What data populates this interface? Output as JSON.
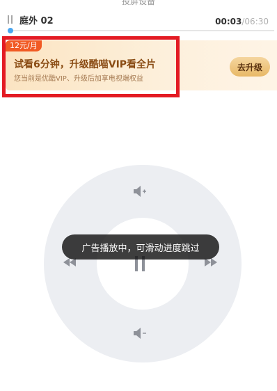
{
  "header": {
    "top_title_cut": "投屏设备"
  },
  "now_playing": {
    "title": "庭外 02",
    "current_time": "00:03",
    "separator_total": "/06:30",
    "progress_fraction": 0.008
  },
  "vip_banner": {
    "price_tag": "12元/月",
    "title": "试看6分钟，升级酷喵VIP看全片",
    "subtitle": "您当前是优酷VIP、升级后加享电视端权益",
    "button_label": "去升级",
    "accent_color": "#f15a24"
  },
  "remote": {
    "controls": [
      "volume-up-icon",
      "volume-down-icon",
      "rewind-icon",
      "fast-forward-icon",
      "pause-icon"
    ],
    "ring_color": "#eceef2",
    "icon_color": "#8e9199"
  },
  "toast": {
    "message": "广告播放中，可滑动进度跳过"
  },
  "highlight_color": "#e31b23"
}
